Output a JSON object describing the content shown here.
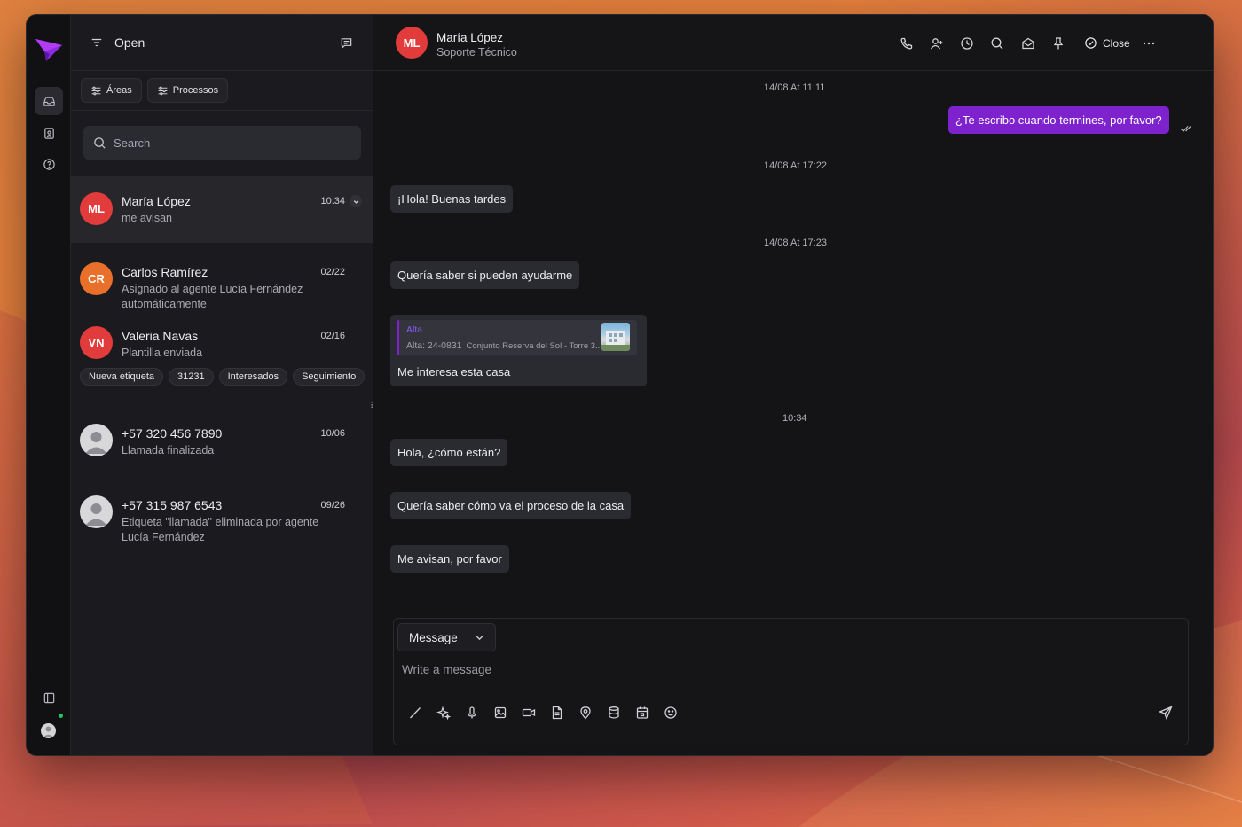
{
  "colors": {
    "accent": "#7e22ce",
    "avatar_red": "#e23b3b",
    "avatar_orange": "#e8702a",
    "online": "#22c55e"
  },
  "rail": {
    "logo_icon": "paper-plane-logo",
    "items": [
      {
        "icon": "inbox-icon",
        "active": true
      },
      {
        "icon": "contacts-book-icon",
        "active": false
      },
      {
        "icon": "help-circle-icon",
        "active": false
      }
    ],
    "bottom": {
      "panel_icon": "sidebar-toggle-icon",
      "avatar_icon": "user-avatar-icon",
      "status": "online"
    }
  },
  "list": {
    "header": {
      "title": "Open",
      "filter_icon": "filter-lines-icon",
      "note_icon": "message-square-icon"
    },
    "filters": [
      {
        "label": "Áreas",
        "icon": "sliders-icon"
      },
      {
        "label": "Processos",
        "icon": "sliders-icon"
      }
    ],
    "search_placeholder": "Search",
    "conversations": [
      {
        "initials": "ML",
        "name": "María López",
        "time": "10:34",
        "preview": "me avisan",
        "color": "#e23b3b"
      },
      {
        "initials": "CR",
        "name": "Carlos Ramírez",
        "time": "02/22",
        "preview": "Asignado al agente Lucía Fernández automáticamente",
        "color": "#e8702a"
      },
      {
        "initials": "VN",
        "name": "Valeria Navas",
        "time": "02/16",
        "preview": "Plantilla enviada",
        "color": "#e23b3b",
        "tags": [
          "Nueva etiqueta",
          "31231",
          "Interesados",
          "Seguimiento"
        ]
      },
      {
        "initials": "",
        "name": "+57 320 456 7890",
        "time": "10/06",
        "preview": "Llamada finalizada",
        "color": "#d8d8db"
      },
      {
        "initials": "",
        "name": "+57 315 987 6543",
        "time": "09/26",
        "preview": "Etiqueta \"llamada\" eliminada por agente Lucía Fernández",
        "color": "#d8d8db"
      }
    ]
  },
  "chat": {
    "contact": {
      "initials": "ML",
      "name": "María López",
      "subtitle": "Soporte Técnico"
    },
    "toolbar": {
      "icons": [
        "phone-icon",
        "add-user-icon",
        "clock-icon",
        "search-icon",
        "mail-open-icon",
        "pin-icon"
      ],
      "close_label": "Close",
      "more_icon": "more-horizontal-icon"
    },
    "timestamps": [
      "14/08 At 11:11",
      "14/08 At 17:22",
      "14/08 At 17:23",
      "10:34"
    ],
    "messages": [
      {
        "dir": "out",
        "text": "¿Te escribo cuando termines, por favor?"
      },
      {
        "dir": "in",
        "text": "¡Hola! Buenas tardes"
      },
      {
        "dir": "in",
        "text": "Quería saber si pueden ayudarme"
      },
      {
        "dir": "in",
        "text": "Me interesa esta casa",
        "quote": {
          "tag": "Alta",
          "ref": "Alta: 24-0831",
          "project": "Conjunto Reserva del Sol - Torre 3..."
        }
      },
      {
        "dir": "in",
        "text": "Hola, ¿cómo están?"
      },
      {
        "dir": "in",
        "text": "Quería saber cómo va el proceso de la casa"
      },
      {
        "dir": "in",
        "text": "Me avisan, por favor"
      }
    ],
    "composer": {
      "mode": "Message",
      "placeholder": "Write a message",
      "tools": [
        "slash-command-icon",
        "sparkles-icon",
        "microphone-icon",
        "image-icon",
        "video-icon",
        "document-icon",
        "location-pin-icon",
        "database-icon",
        "calendar-icon",
        "emoji-icon"
      ],
      "send_icon": "send-icon"
    }
  }
}
